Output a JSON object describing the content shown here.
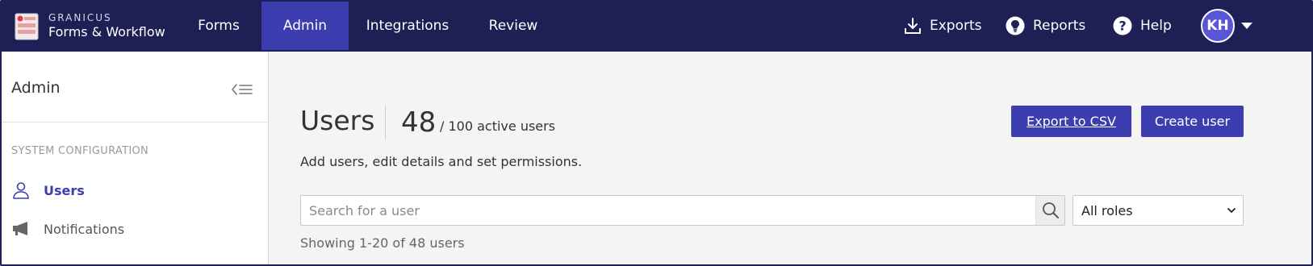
{
  "brand": {
    "top": "GRANICUS",
    "bottom": "Forms & Workflow"
  },
  "nav": {
    "items": [
      {
        "label": "Forms"
      },
      {
        "label": "Admin"
      },
      {
        "label": "Integrations"
      },
      {
        "label": "Review"
      }
    ],
    "active": "Admin",
    "exports": "Exports",
    "reports": "Reports",
    "help": "Help",
    "avatar_initials": "KH"
  },
  "sidebar": {
    "title": "Admin",
    "section_label": "SYSTEM CONFIGURATION",
    "items": [
      {
        "label": "Users",
        "icon": "user-icon",
        "active": true
      },
      {
        "label": "Notifications",
        "icon": "megaphone-icon",
        "active": false
      }
    ]
  },
  "main": {
    "title": "Users",
    "count": "48",
    "count_sub": "/ 100 active users",
    "subtitle": "Add users, edit details and set permissions.",
    "export_label": "Export to CSV",
    "create_label": "Create user",
    "search_placeholder": "Search for a user",
    "role_filter": "All roles",
    "showing": "Showing 1-20 of 48 users"
  },
  "colors": {
    "nav_bg": "#1e1f55",
    "nav_active": "#3c3eb0",
    "accent": "#3c3eb0",
    "avatar": "#5855d6",
    "page_bg": "#f4f4f4"
  }
}
